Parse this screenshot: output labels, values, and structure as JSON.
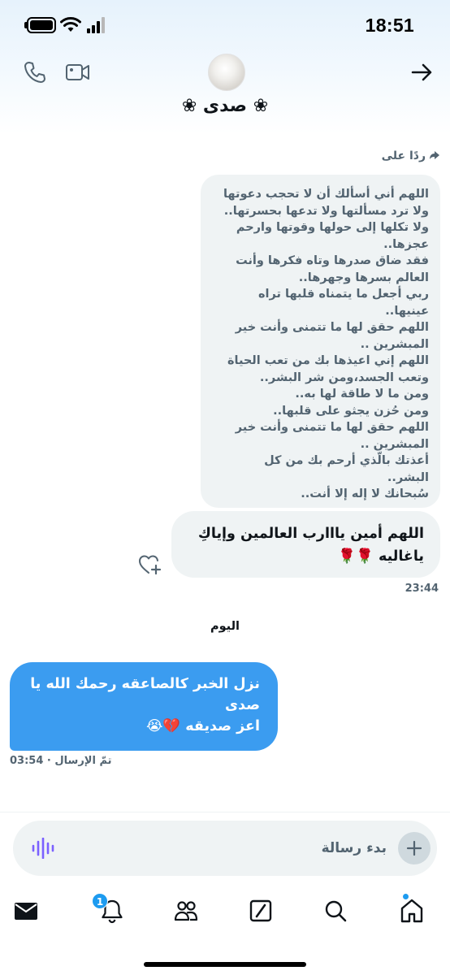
{
  "status_bar": {
    "time": "18:51"
  },
  "header": {
    "contact_name": "❀ صدى ❀",
    "icons": {
      "call": "phone-icon",
      "video": "video-icon",
      "back": "arrow-right-icon"
    }
  },
  "conversation": {
    "reply_label": "ردًا على",
    "quoted_lines": [
      "اللهم أني أسألك أن لا تحجب دعوتها",
      "ولا ترد مسألتها ولا تدعها بحسرتها..",
      "ولا تكلها إلى حولها وقوتها وارحم",
      "عجزها..",
      "فقد ضاق صدرها وتاه فكرها وأنت",
      "العالم بسرها وجهرها..",
      "ربي أجعل ما يتمناه قلبها تراه",
      "عينيها..",
      "اللهم حقق لها ما تتمنى وأنت خير",
      "المبشرين ..",
      "اللهم إني اعيذها بك من تعب الحياة",
      "وتعب الجسد،ومن شر البشر..",
      "ومن ما لا طاقة لها به..",
      "ومن حُزن يجثو على قلبها..",
      "اللهم حقق لها ما تتمنى وأنت خير",
      "المبشرين ..",
      "أعذتك بالّذي أرحم بك من كل",
      "البشر..",
      "سُبحانك لا إله إلا أنت.."
    ],
    "my_message_lines": [
      "اللهم أمين يااارب العالمين وإياكِ",
      "ياغاليه 🌹🌹"
    ],
    "my_message_time": "23:44",
    "day_separator": "اليوم",
    "their_message_lines": [
      "نزل الخبر كالصاعقه رحمك الله يا",
      "صدى",
      "اعز صديقه 💔😭"
    ],
    "sent_meta": "تمّ الإرسال · 03:54"
  },
  "composer": {
    "placeholder": "بدء رسالة",
    "value": ""
  },
  "nav": {
    "items": [
      "mail-icon",
      "bell-icon",
      "people-icon",
      "grok-icon",
      "search-icon",
      "home-icon"
    ],
    "notification_count": "1"
  },
  "colors": {
    "accent": "#1d9bf0",
    "incoming_bubble": "#3b9cf0",
    "outgoing_bubble": "#eff3f4",
    "voice_icon": "#7b61ff"
  }
}
